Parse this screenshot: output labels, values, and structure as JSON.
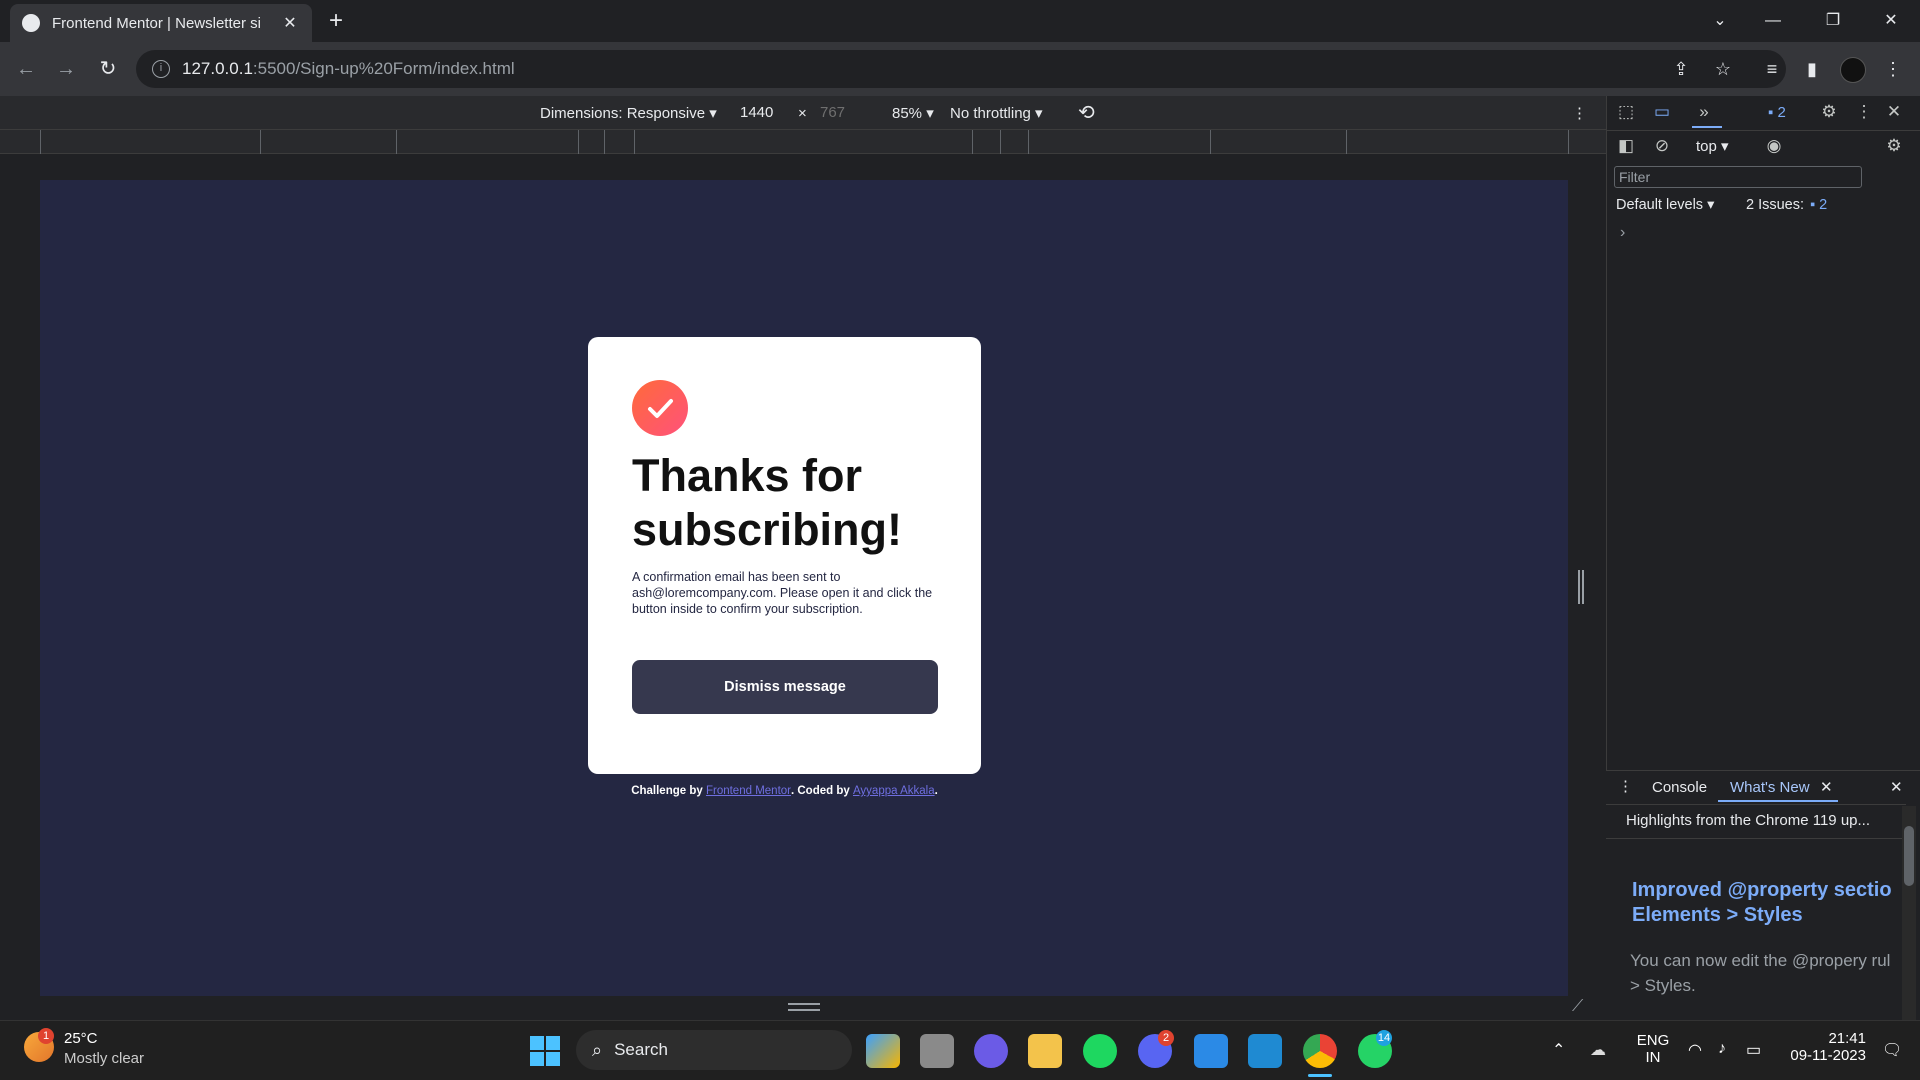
{
  "browser": {
    "tab_title": "Frontend Mentor | Newsletter si",
    "url_host": "127.0.0.1",
    "url_path": ":5500/Sign-up%20Form/index.html"
  },
  "device_toolbar": {
    "dimensions": "Dimensions: Responsive ▾",
    "width": "1440",
    "x": "×",
    "height": "767",
    "zoom": "85% ▾",
    "throttling": "No throttling ▾"
  },
  "card": {
    "heading": "Thanks for subscribing!",
    "body": "A confirmation email has been sent to ash@loremcompany.com. Please open it and click the button inside to confirm your subscription.",
    "button": "Dismiss message"
  },
  "attribution": {
    "prefix": "Challenge by ",
    "link1": "Frontend Mentor",
    "middle": ". Coded by ",
    "link2": "Ayyappa Akkala",
    "suffix": "."
  },
  "devtools": {
    "context": "top ▾",
    "issues_badge": "2",
    "filter_placeholder": "Filter",
    "levels": "Default levels ▾",
    "issues_label": "2 Issues:",
    "issues_count": "2",
    "prompt": "›",
    "drawer_tab_console": "Console",
    "drawer_tab_whatsnew": "What's New",
    "highlights": "Highlights from the Chrome 119 up...",
    "whatsnew_title_1": "Improved @property sectio",
    "whatsnew_title_2": "Elements > Styles",
    "whatsnew_body_1": "You can now edit the @propery rul",
    "whatsnew_body_2": "> Styles."
  },
  "taskbar": {
    "weather_temp": "25°C",
    "weather_desc": "Mostly clear",
    "weather_badge": "1",
    "search": "Search",
    "discord_badge": "2",
    "whatsapp_badge": "14",
    "lang1": "ENG",
    "lang2": "IN",
    "time": "21:41",
    "date": "09-11-2023"
  }
}
